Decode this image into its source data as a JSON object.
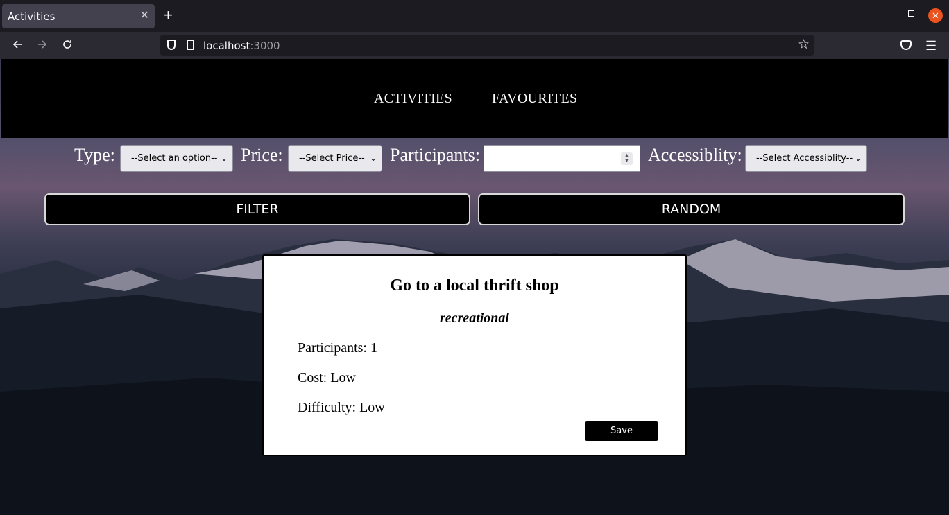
{
  "browser": {
    "tab_title": "Activities",
    "tab_close": "✕",
    "new_tab": "+",
    "url_host": "localhost",
    "url_port": ":3000",
    "window_controls": {
      "minimize": "–",
      "close": "✕"
    }
  },
  "header": {
    "nav": [
      {
        "label": "ACTIVITIES"
      },
      {
        "label": "FAVOURITES"
      }
    ]
  },
  "filters": {
    "type_label": "Type:",
    "type_value": "--Select an option--",
    "price_label": "Price:",
    "price_value": "--Select Price--",
    "participants_label": "Participants:",
    "participants_value": "",
    "accessibility_label": "Accessiblity:",
    "accessibility_value": "--Select Accessiblity--",
    "filter_button": "FILTER",
    "random_button": "RANDOM"
  },
  "activity": {
    "title": "Go to a local thrift shop",
    "type": "recreational",
    "participants": "Participants: 1",
    "cost": "Cost: Low",
    "difficulty": "Difficulty: Low",
    "save_button": "Save"
  },
  "icons": {
    "back": "back-arrow-icon",
    "forward": "forward-arrow-icon",
    "reload": "reload-icon",
    "shield": "shield-icon",
    "page": "page-icon",
    "star": "bookmark-star-icon",
    "pocket": "pocket-icon",
    "menu": "hamburger-menu-icon"
  },
  "colors": {
    "header_bg": "#000000",
    "card_bg": "#ffffff",
    "button_bg": "#000000",
    "close_button": "#e95420"
  }
}
